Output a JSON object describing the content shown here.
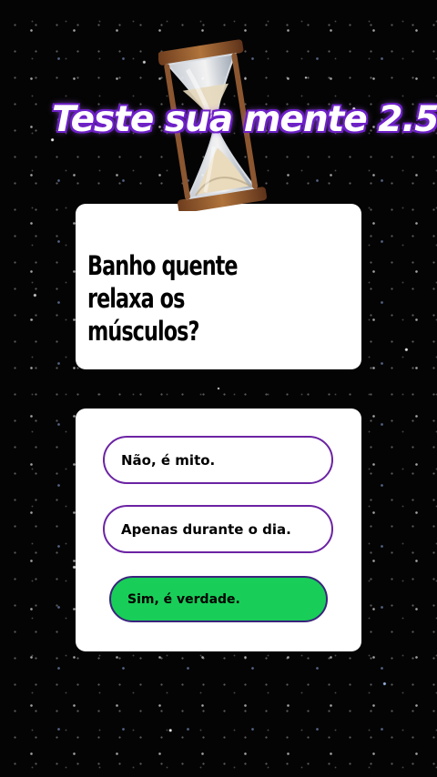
{
  "header": {
    "title": "Teste sua mente 2.5",
    "icon": "hourglass-icon"
  },
  "question": {
    "text": "Banho quente relaxa os músculos?"
  },
  "answers": {
    "options": [
      {
        "label": "Não, é mito."
      },
      {
        "label": "Apenas durante o dia."
      },
      {
        "label": "Sim, é verdade."
      }
    ]
  },
  "colors": {
    "background": "#050505",
    "card_background": "#ffffff",
    "option_border": "#6b23a3",
    "correct_option_fill": "#18ce58",
    "title_outline": "#6e20c8"
  }
}
